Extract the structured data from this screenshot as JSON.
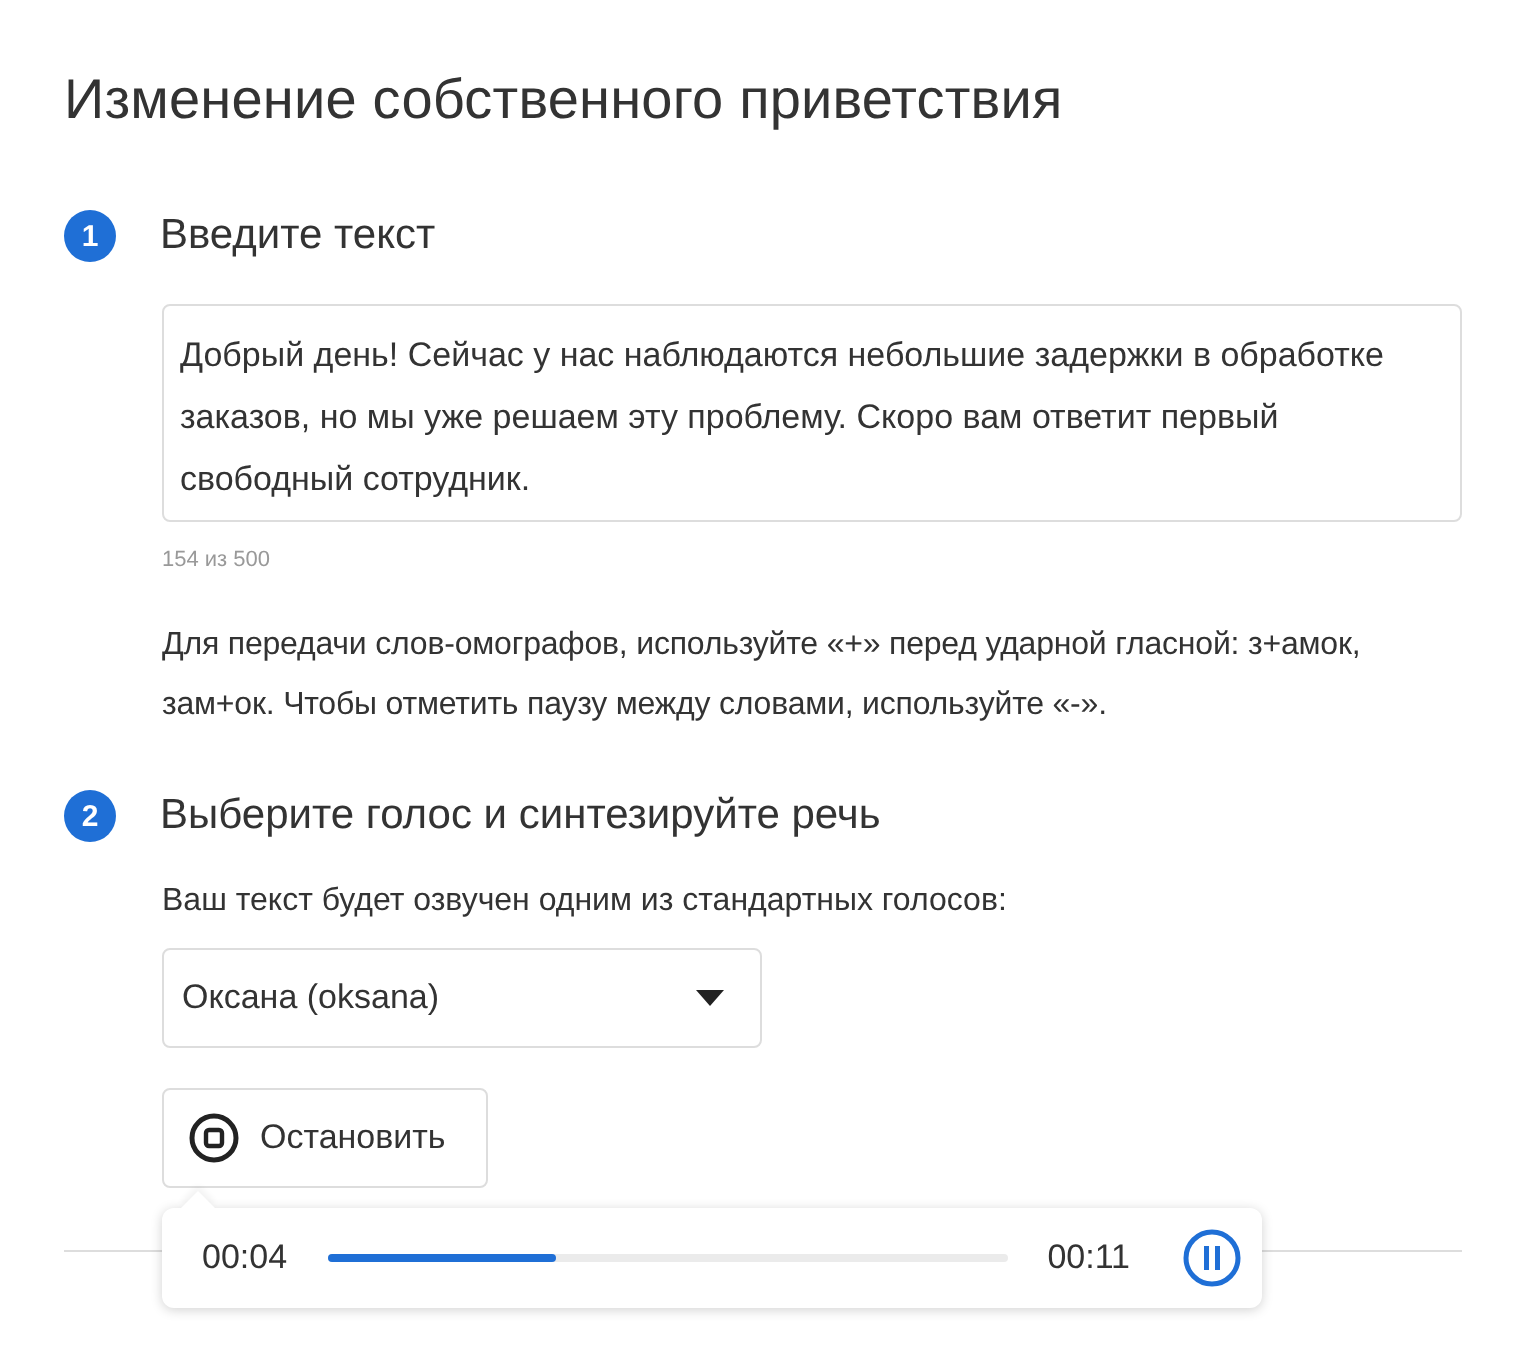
{
  "title": "Изменение собственного приветствия",
  "steps": [
    {
      "number": "1",
      "heading": "Введите текст"
    },
    {
      "number": "2",
      "heading": "Выберите голос и синтезируйте речь"
    }
  ],
  "greeting": {
    "value": "Добрый день! Сейчас у нас наблюдаются небольшие задержки в обработке заказов, но мы уже решаем эту проблему. Скоро вам ответит первый свободный сотрудник.",
    "counter": "154 из 500"
  },
  "hint": "Для передачи слов-омографов, используйте «+» перед ударной гласной: з+амок, зам+ок. Чтобы отметить паузу между словами, используйте «-».",
  "voice_note": "Ваш текст будет озвучен одним из стандартных голосов:",
  "voice_select": {
    "value": "Оксана (oksana)"
  },
  "stop_button": {
    "label": "Остановить"
  },
  "player": {
    "elapsed": "00:04",
    "total": "00:11",
    "level": 0.335,
    "playing": true
  }
}
